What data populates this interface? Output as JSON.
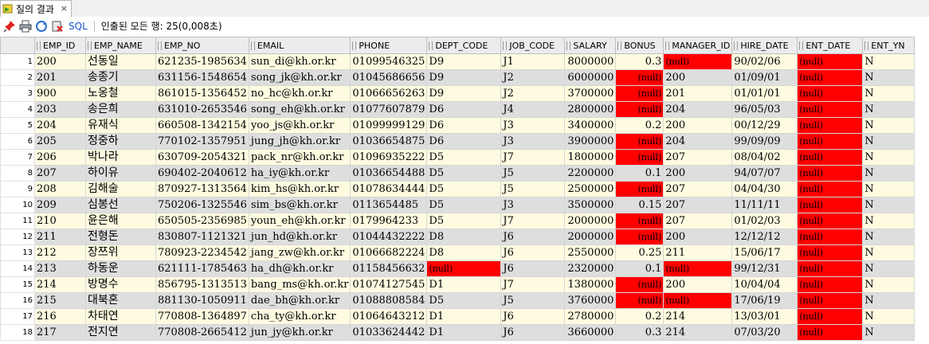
{
  "tab": {
    "label": "질의 결과",
    "close": "×"
  },
  "toolbar": {
    "sql_label": "SQL",
    "status": "인출된 모든 행: 25(0,008초)"
  },
  "null_text": "(null)",
  "colors": {
    "null_bg": "#ff0000",
    "row_odd": "#fffbe0",
    "row_even": "#dedede",
    "sql_link": "#1c53c8"
  },
  "columns": [
    "EMP_ID",
    "EMP_NAME",
    "EMP_NO",
    "EMAIL",
    "PHONE",
    "DEPT_CODE",
    "JOB_CODE",
    "SALARY",
    "BONUS",
    "MANAGER_ID",
    "HIRE_DATE",
    "ENT_DATE",
    "ENT_YN"
  ],
  "rows": [
    {
      "rn": "1",
      "EMP_ID": "200",
      "EMP_NAME": "선동일",
      "EMP_NO": "621235-1985634",
      "EMAIL": "sun_di@kh.or.kr",
      "PHONE": "01099546325",
      "DEPT_CODE": "D9",
      "JOB_CODE": "J1",
      "SALARY": "8000000",
      "BONUS": "0.3",
      "MANAGER_ID": null,
      "HIRE_DATE": "90/02/06",
      "ENT_DATE": null,
      "ENT_YN": "N"
    },
    {
      "rn": "2",
      "EMP_ID": "201",
      "EMP_NAME": "송종기",
      "EMP_NO": "631156-1548654",
      "EMAIL": "song_jk@kh.or.kr",
      "PHONE": "01045686656",
      "DEPT_CODE": "D9",
      "JOB_CODE": "J2",
      "SALARY": "6000000",
      "BONUS": null,
      "MANAGER_ID": "200",
      "HIRE_DATE": "01/09/01",
      "ENT_DATE": null,
      "ENT_YN": "N"
    },
    {
      "rn": "3",
      "EMP_ID": "900",
      "EMP_NAME": "노옹철",
      "EMP_NO": "861015-1356452",
      "EMAIL": "no_hc@kh.or.kr",
      "PHONE": "01066656263",
      "DEPT_CODE": "D9",
      "JOB_CODE": "J2",
      "SALARY": "3700000",
      "BONUS": null,
      "MANAGER_ID": "201",
      "HIRE_DATE": "01/01/01",
      "ENT_DATE": null,
      "ENT_YN": "N"
    },
    {
      "rn": "4",
      "EMP_ID": "203",
      "EMP_NAME": "송은희",
      "EMP_NO": "631010-2653546",
      "EMAIL": "song_eh@kh.or.kr",
      "PHONE": "01077607879",
      "DEPT_CODE": "D6",
      "JOB_CODE": "J4",
      "SALARY": "2800000",
      "BONUS": null,
      "MANAGER_ID": "204",
      "HIRE_DATE": "96/05/03",
      "ENT_DATE": null,
      "ENT_YN": "N"
    },
    {
      "rn": "5",
      "EMP_ID": "204",
      "EMP_NAME": "유재식",
      "EMP_NO": "660508-1342154",
      "EMAIL": "yoo_js@kh.or.kr",
      "PHONE": "01099999129",
      "DEPT_CODE": "D6",
      "JOB_CODE": "J3",
      "SALARY": "3400000",
      "BONUS": "0.2",
      "MANAGER_ID": "200",
      "HIRE_DATE": "00/12/29",
      "ENT_DATE": null,
      "ENT_YN": "N"
    },
    {
      "rn": "6",
      "EMP_ID": "205",
      "EMP_NAME": "정중하",
      "EMP_NO": "770102-1357951",
      "EMAIL": "jung_jh@kh.or.kr",
      "PHONE": "01036654875",
      "DEPT_CODE": "D6",
      "JOB_CODE": "J3",
      "SALARY": "3900000",
      "BONUS": null,
      "MANAGER_ID": "204",
      "HIRE_DATE": "99/09/09",
      "ENT_DATE": null,
      "ENT_YN": "N"
    },
    {
      "rn": "7",
      "EMP_ID": "206",
      "EMP_NAME": "박나라",
      "EMP_NO": "630709-2054321",
      "EMAIL": "pack_nr@kh.or.kr",
      "PHONE": "01096935222",
      "DEPT_CODE": "D5",
      "JOB_CODE": "J7",
      "SALARY": "1800000",
      "BONUS": null,
      "MANAGER_ID": "207",
      "HIRE_DATE": "08/04/02",
      "ENT_DATE": null,
      "ENT_YN": "N"
    },
    {
      "rn": "8",
      "EMP_ID": "207",
      "EMP_NAME": "하이유",
      "EMP_NO": "690402-2040612",
      "EMAIL": "ha_iy@kh.or.kr",
      "PHONE": "01036654488",
      "DEPT_CODE": "D5",
      "JOB_CODE": "J5",
      "SALARY": "2200000",
      "BONUS": "0.1",
      "MANAGER_ID": "200",
      "HIRE_DATE": "94/07/07",
      "ENT_DATE": null,
      "ENT_YN": "N"
    },
    {
      "rn": "9",
      "EMP_ID": "208",
      "EMP_NAME": "김해술",
      "EMP_NO": "870927-1313564",
      "EMAIL": "kim_hs@kh.or.kr",
      "PHONE": "01078634444",
      "DEPT_CODE": "D5",
      "JOB_CODE": "J5",
      "SALARY": "2500000",
      "BONUS": null,
      "MANAGER_ID": "207",
      "HIRE_DATE": "04/04/30",
      "ENT_DATE": null,
      "ENT_YN": "N"
    },
    {
      "rn": "10",
      "EMP_ID": "209",
      "EMP_NAME": "심봉선",
      "EMP_NO": "750206-1325546",
      "EMAIL": "sim_bs@kh.or.kr",
      "PHONE": "0113654485",
      "DEPT_CODE": "D5",
      "JOB_CODE": "J3",
      "SALARY": "3500000",
      "BONUS": "0.15",
      "MANAGER_ID": "207",
      "HIRE_DATE": "11/11/11",
      "ENT_DATE": null,
      "ENT_YN": "N"
    },
    {
      "rn": "11",
      "EMP_ID": "210",
      "EMP_NAME": "윤은해",
      "EMP_NO": "650505-2356985",
      "EMAIL": "youn_eh@kh.or.kr",
      "PHONE": "0179964233",
      "DEPT_CODE": "D5",
      "JOB_CODE": "J7",
      "SALARY": "2000000",
      "BONUS": null,
      "MANAGER_ID": "207",
      "HIRE_DATE": "01/02/03",
      "ENT_DATE": null,
      "ENT_YN": "N"
    },
    {
      "rn": "12",
      "EMP_ID": "211",
      "EMP_NAME": "전형돈",
      "EMP_NO": "830807-1121321",
      "EMAIL": "jun_hd@kh.or.kr",
      "PHONE": "01044432222",
      "DEPT_CODE": "D8",
      "JOB_CODE": "J6",
      "SALARY": "2000000",
      "BONUS": null,
      "MANAGER_ID": "200",
      "HIRE_DATE": "12/12/12",
      "ENT_DATE": null,
      "ENT_YN": "N"
    },
    {
      "rn": "13",
      "EMP_ID": "212",
      "EMP_NAME": "장쯔위",
      "EMP_NO": "780923-2234542",
      "EMAIL": "jang_zw@kh.or.kr",
      "PHONE": "01066682224",
      "DEPT_CODE": "D8",
      "JOB_CODE": "J6",
      "SALARY": "2550000",
      "BONUS": "0.25",
      "MANAGER_ID": "211",
      "HIRE_DATE": "15/06/17",
      "ENT_DATE": null,
      "ENT_YN": "N"
    },
    {
      "rn": "14",
      "EMP_ID": "213",
      "EMP_NAME": "하동운",
      "EMP_NO": "621111-1785463",
      "EMAIL": "ha_dh@kh.or.kr",
      "PHONE": "01158456632",
      "DEPT_CODE": null,
      "JOB_CODE": "J6",
      "SALARY": "2320000",
      "BONUS": "0.1",
      "MANAGER_ID": null,
      "HIRE_DATE": "99/12/31",
      "ENT_DATE": null,
      "ENT_YN": "N"
    },
    {
      "rn": "15",
      "EMP_ID": "214",
      "EMP_NAME": "방명수",
      "EMP_NO": "856795-1313513",
      "EMAIL": "bang_ms@kh.or.kr",
      "PHONE": "01074127545",
      "DEPT_CODE": "D1",
      "JOB_CODE": "J7",
      "SALARY": "1380000",
      "BONUS": null,
      "MANAGER_ID": "200",
      "HIRE_DATE": "10/04/04",
      "ENT_DATE": null,
      "ENT_YN": "N"
    },
    {
      "rn": "16",
      "EMP_ID": "215",
      "EMP_NAME": "대북혼",
      "EMP_NO": "881130-1050911",
      "EMAIL": "dae_bh@kh.or.kr",
      "PHONE": "01088808584",
      "DEPT_CODE": "D5",
      "JOB_CODE": "J5",
      "SALARY": "3760000",
      "BONUS": null,
      "MANAGER_ID": null,
      "HIRE_DATE": "17/06/19",
      "ENT_DATE": null,
      "ENT_YN": "N"
    },
    {
      "rn": "17",
      "EMP_ID": "216",
      "EMP_NAME": "차태연",
      "EMP_NO": "770808-1364897",
      "EMAIL": "cha_ty@kh.or.kr",
      "PHONE": "01064643212",
      "DEPT_CODE": "D1",
      "JOB_CODE": "J6",
      "SALARY": "2780000",
      "BONUS": "0.2",
      "MANAGER_ID": "214",
      "HIRE_DATE": "13/03/01",
      "ENT_DATE": null,
      "ENT_YN": "N"
    },
    {
      "rn": "18",
      "EMP_ID": "217",
      "EMP_NAME": "전지연",
      "EMP_NO": "770808-2665412",
      "EMAIL": "jun_jy@kh.or.kr",
      "PHONE": "01033624442",
      "DEPT_CODE": "D1",
      "JOB_CODE": "J6",
      "SALARY": "3660000",
      "BONUS": "0.3",
      "MANAGER_ID": "214",
      "HIRE_DATE": "07/03/20",
      "ENT_DATE": null,
      "ENT_YN": "N"
    }
  ]
}
